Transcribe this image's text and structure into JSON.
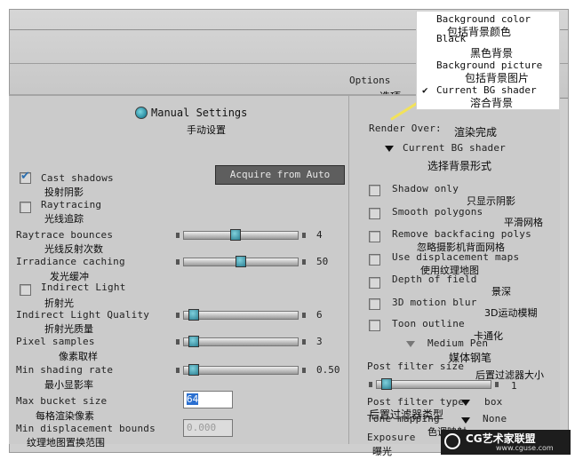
{
  "left_panel": {
    "title": "Manual Settings",
    "title_zh": "手动设置",
    "acquire_button": "Acquire from Auto",
    "cast_shadows": {
      "label": "Cast shadows",
      "zh": "投射阴影",
      "checked": true
    },
    "raytracing": {
      "label": "Raytracing",
      "zh": "光线追踪",
      "checked": false
    },
    "raytrace_bounces": {
      "label": "Raytrace bounces",
      "zh": "光线反射次数",
      "value": "4",
      "level": 0.45
    },
    "irradiance_caching": {
      "label": "Irradiance caching",
      "zh": "发光缓冲",
      "value": "50",
      "level": 0.5
    },
    "indirect_light": {
      "label": "Indirect Light",
      "zh": "折射光",
      "checked": false
    },
    "indirect_light_quality": {
      "label": "Indirect Light Quality",
      "zh": "折射光质量",
      "value": "6",
      "level": 0.05
    },
    "pixel_samples": {
      "label": "Pixel samples",
      "zh": "像素取样",
      "value": "3",
      "level": 0.05
    },
    "min_shading_rate": {
      "label": "Min shading rate",
      "zh": "最小显影率",
      "value": "0.50",
      "level": 0.05
    },
    "max_bucket_size": {
      "label": "Max bucket size",
      "zh": "每格渲染像素",
      "value": "64"
    },
    "min_displacement_bounds": {
      "label": "Min displacement bounds",
      "zh": "纹理地图置换范围",
      "value": "0.000"
    }
  },
  "right_panel": {
    "options_tab": "Options",
    "options_tab_zh": "选项",
    "render_over_label": "Render Over:",
    "render_over_zh": "渲染完成",
    "render_over_value": "Current BG shader",
    "render_over_value_zh": "选择背景形式",
    "shadow_only": {
      "label": "Shadow only",
      "zh": "只显示阴影",
      "checked": false
    },
    "smooth_polygons": {
      "label": "Smooth polygons",
      "zh": "平滑网格",
      "checked": false
    },
    "remove_backfacing": {
      "label": "Remove backfacing polys",
      "zh": "忽略摄影机背面网格",
      "checked": false
    },
    "use_displacement": {
      "label": "Use displacement maps",
      "zh": "使用纹理地图",
      "checked": false
    },
    "depth_of_field": {
      "label": "Depth of field",
      "zh": "景深",
      "checked": false
    },
    "motion_blur": {
      "label": "3D motion blur",
      "zh": "3D运动模糊",
      "checked": false
    },
    "toon_outline": {
      "label": "Toon outline",
      "zh": "卡通化",
      "checked": false
    },
    "medium_pen": {
      "label": "Medium Pen",
      "zh": "媒体钢笔"
    },
    "post_filter_size": {
      "label": "Post filter size",
      "zh": "后置过滤器大小",
      "value": "1",
      "level": 0.05
    },
    "post_filter_type": {
      "label": "Post filter type",
      "trailing": "box",
      "zh": "后置过滤器类型"
    },
    "tone_mapping": {
      "label": "Tone mapping",
      "value": "None",
      "zh": "色调映射"
    },
    "exposure": {
      "label": "Exposure",
      "zh": "曝光"
    }
  },
  "render_over_menu": {
    "items": [
      {
        "label": "Background color",
        "zh": "包括背景颜色"
      },
      {
        "label": "Black",
        "zh": "黑色背景"
      },
      {
        "label": "Background picture",
        "zh": "包括背景图片"
      },
      {
        "label": "Current BG shader",
        "zh": "溶合背景",
        "selected": true
      }
    ],
    "check_mark": "✔"
  },
  "watermark": {
    "text": "CG艺术家联盟",
    "url": "www.cguse.com"
  },
  "colors": {
    "accent": "#2b7f92",
    "panel": "#cbcbcb",
    "highlight_line": "#f2e25a"
  }
}
